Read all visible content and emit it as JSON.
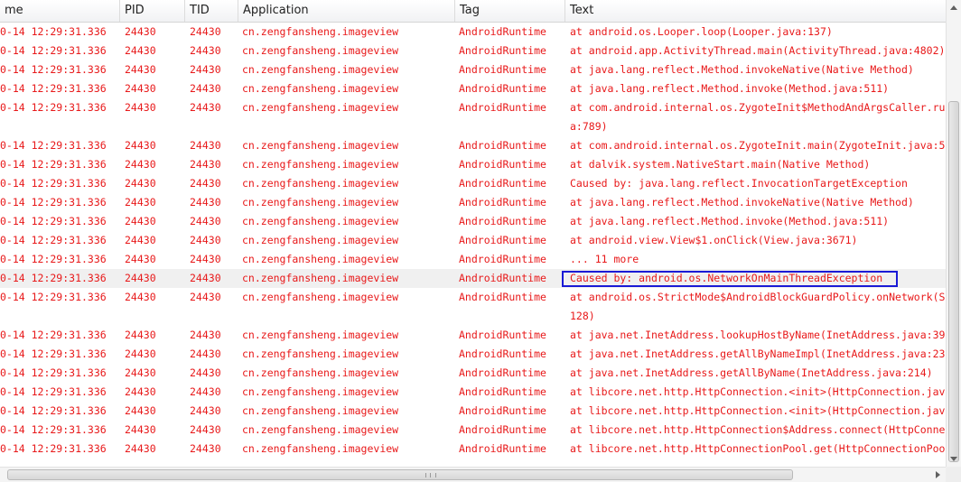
{
  "columns": {
    "time": "me",
    "pid": "PID",
    "tid": "TID",
    "application": "Application",
    "tag": "Tag",
    "text": "Text"
  },
  "rows": [
    {
      "time": "0-14 12:29:31.336",
      "pid": "24430",
      "tid": "24430",
      "app": "cn.zengfansheng.imageview",
      "tag": "AndroidRuntime",
      "text": "at android.os.Looper.loop(Looper.java:137)"
    },
    {
      "time": "0-14 12:29:31.336",
      "pid": "24430",
      "tid": "24430",
      "app": "cn.zengfansheng.imageview",
      "tag": "AndroidRuntime",
      "text": "at android.app.ActivityThread.main(ActivityThread.java:4802)"
    },
    {
      "time": "0-14 12:29:31.336",
      "pid": "24430",
      "tid": "24430",
      "app": "cn.zengfansheng.imageview",
      "tag": "AndroidRuntime",
      "text": "at java.lang.reflect.Method.invokeNative(Native Method)"
    },
    {
      "time": "0-14 12:29:31.336",
      "pid": "24430",
      "tid": "24430",
      "app": "cn.zengfansheng.imageview",
      "tag": "AndroidRuntime",
      "text": "at java.lang.reflect.Method.invoke(Method.java:511)"
    },
    {
      "time": "0-14 12:29:31.336",
      "pid": "24430",
      "tid": "24430",
      "app": "cn.zengfansheng.imageview",
      "tag": "AndroidRuntime",
      "text": "at com.android.internal.os.ZygoteInit$MethodAndArgsCaller.ru",
      "text2": "a:789)"
    },
    {
      "time": "0-14 12:29:31.336",
      "pid": "24430",
      "tid": "24430",
      "app": "cn.zengfansheng.imageview",
      "tag": "AndroidRuntime",
      "text": "at com.android.internal.os.ZygoteInit.main(ZygoteInit.java:5"
    },
    {
      "time": "0-14 12:29:31.336",
      "pid": "24430",
      "tid": "24430",
      "app": "cn.zengfansheng.imageview",
      "tag": "AndroidRuntime",
      "text": "at dalvik.system.NativeStart.main(Native Method)"
    },
    {
      "time": "0-14 12:29:31.336",
      "pid": "24430",
      "tid": "24430",
      "app": "cn.zengfansheng.imageview",
      "tag": "AndroidRuntime",
      "text": "Caused by: java.lang.reflect.InvocationTargetException"
    },
    {
      "time": "0-14 12:29:31.336",
      "pid": "24430",
      "tid": "24430",
      "app": "cn.zengfansheng.imageview",
      "tag": "AndroidRuntime",
      "text": "at java.lang.reflect.Method.invokeNative(Native Method)"
    },
    {
      "time": "0-14 12:29:31.336",
      "pid": "24430",
      "tid": "24430",
      "app": "cn.zengfansheng.imageview",
      "tag": "AndroidRuntime",
      "text": "at java.lang.reflect.Method.invoke(Method.java:511)"
    },
    {
      "time": "0-14 12:29:31.336",
      "pid": "24430",
      "tid": "24430",
      "app": "cn.zengfansheng.imageview",
      "tag": "AndroidRuntime",
      "text": "at android.view.View$1.onClick(View.java:3671)"
    },
    {
      "time": "0-14 12:29:31.336",
      "pid": "24430",
      "tid": "24430",
      "app": "cn.zengfansheng.imageview",
      "tag": "AndroidRuntime",
      "text": "... 11 more"
    },
    {
      "time": "0-14 12:29:31.336",
      "pid": "24430",
      "tid": "24430",
      "app": "cn.zengfansheng.imageview",
      "tag": "AndroidRuntime",
      "text": "Caused by: android.os.NetworkOnMainThreadException"
    },
    {
      "time": "0-14 12:29:31.336",
      "pid": "24430",
      "tid": "24430",
      "app": "cn.zengfansheng.imageview",
      "tag": "AndroidRuntime",
      "text": "at android.os.StrictMode$AndroidBlockGuardPolicy.onNetwork(S",
      "text2": "128)"
    },
    {
      "time": "0-14 12:29:31.336",
      "pid": "24430",
      "tid": "24430",
      "app": "cn.zengfansheng.imageview",
      "tag": "AndroidRuntime",
      "text": "at java.net.InetAddress.lookupHostByName(InetAddress.java:39"
    },
    {
      "time": "0-14 12:29:31.336",
      "pid": "24430",
      "tid": "24430",
      "app": "cn.zengfansheng.imageview",
      "tag": "AndroidRuntime",
      "text": "at java.net.InetAddress.getAllByNameImpl(InetAddress.java:23"
    },
    {
      "time": "0-14 12:29:31.336",
      "pid": "24430",
      "tid": "24430",
      "app": "cn.zengfansheng.imageview",
      "tag": "AndroidRuntime",
      "text": "at java.net.InetAddress.getAllByName(InetAddress.java:214)"
    },
    {
      "time": "0-14 12:29:31.336",
      "pid": "24430",
      "tid": "24430",
      "app": "cn.zengfansheng.imageview",
      "tag": "AndroidRuntime",
      "text": "at libcore.net.http.HttpConnection.<init>(HttpConnection.jav"
    },
    {
      "time": "0-14 12:29:31.336",
      "pid": "24430",
      "tid": "24430",
      "app": "cn.zengfansheng.imageview",
      "tag": "AndroidRuntime",
      "text": "at libcore.net.http.HttpConnection.<init>(HttpConnection.jav"
    },
    {
      "time": "0-14 12:29:31.336",
      "pid": "24430",
      "tid": "24430",
      "app": "cn.zengfansheng.imageview",
      "tag": "AndroidRuntime",
      "text": "at libcore.net.http.HttpConnection$Address.connect(HttpConne"
    },
    {
      "time": "0-14 12:29:31.336",
      "pid": "24430",
      "tid": "24430",
      "app": "cn.zengfansheng.imageview",
      "tag": "AndroidRuntime",
      "text": "at libcore.net.http.HttpConnectionPool.get(HttpConnectionPoo"
    }
  ],
  "selected_row": 12,
  "colors": {
    "log_text": "#e8191a",
    "highlight_border": "#1a1ad6",
    "selected_row_bg": "#f0f0f0"
  }
}
